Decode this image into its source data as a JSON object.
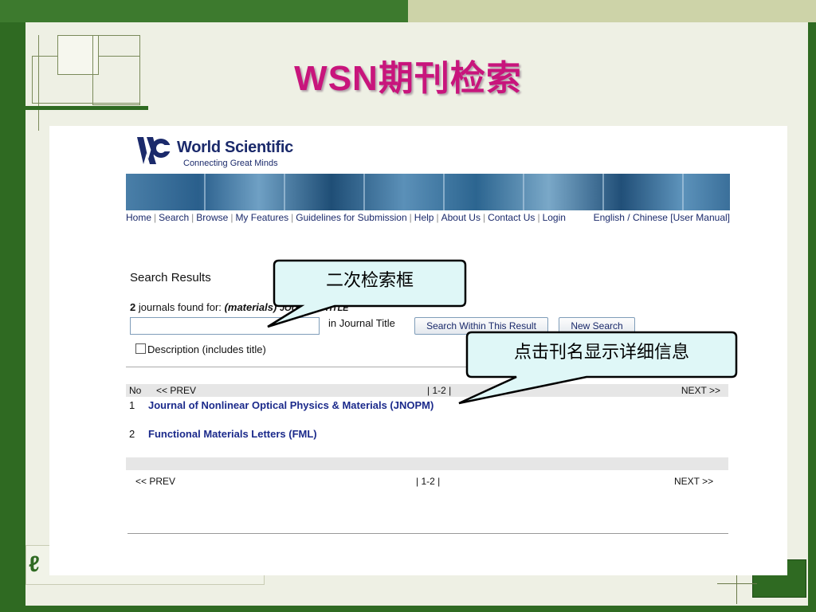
{
  "slide": {
    "title": "WSN期刊检索"
  },
  "logo": {
    "name": "World Scientific",
    "tagline": "Connecting Great Minds"
  },
  "nav": {
    "items": [
      "Home",
      "Search",
      "Browse",
      "My Features",
      "Guidelines for Submission",
      "Help",
      "About Us",
      "Contact Us",
      "Login"
    ],
    "right": "English / Chinese [User Manual]"
  },
  "results": {
    "title": "Search Results",
    "count": "2",
    "found_text": "journals found for:",
    "query": "(materials)",
    "scope": "JOURNAL TITLE",
    "search_value": "",
    "in_label": "in Journal Title",
    "search_within_label": "Search Within This Result",
    "new_search_label": "New Search",
    "checkbox_label": "Description (includes title)"
  },
  "table": {
    "header_no": "No",
    "prev": "<< PREV",
    "pages": "| 1-2 |",
    "next": "NEXT >>",
    "rows": [
      {
        "no": "1",
        "title": "Journal of Nonlinear Optical Physics & Materials (JNOPM)"
      },
      {
        "no": "2",
        "title": "Functional Materials Letters (FML)"
      }
    ]
  },
  "callouts": {
    "search_box": "二次检索框",
    "click_title": "点击刊名显示详细信息"
  },
  "colors": {
    "title": "#c8157c",
    "link": "#1b2a8b",
    "callout_fill": "#dff7f7",
    "frame_green": "#2f6a22"
  }
}
